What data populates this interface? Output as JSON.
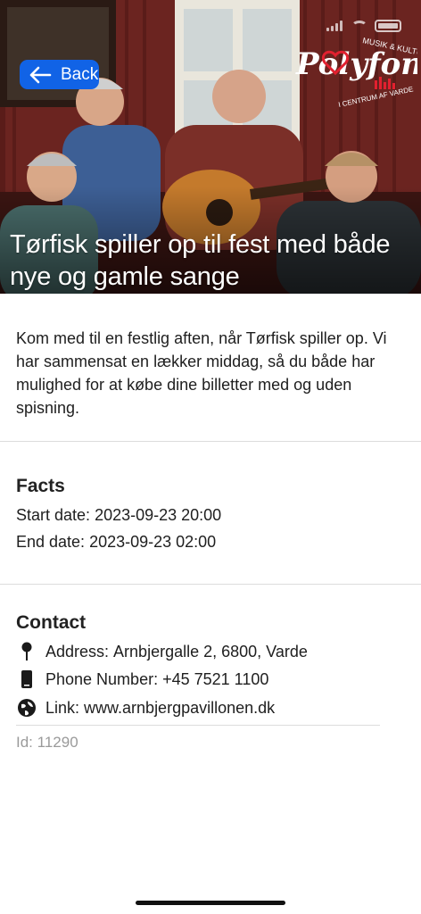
{
  "hero": {
    "title": "Tørfisk spiller op til fest med både nye og gamle sange",
    "back_label": "Back",
    "logo": {
      "wordmark": "Polyfon",
      "tagline_top": "MUSIK & KULTUR",
      "tagline_bottom": "I CENTRUM AF VARDE",
      "colors": {
        "text": "#ffffff",
        "heart": "#e2202f"
      }
    }
  },
  "description": "Kom med til en festlig aften, når Tørfisk spiller op. Vi har sammensat en lækker middag, så du både har mulighed for at købe dine billetter med og uden spisning.",
  "facts": {
    "title": "Facts",
    "start_label": "Start date:",
    "start_value": "2023-09-23 20:00",
    "end_label": "End date:",
    "end_value": "2023-09-23 02:00"
  },
  "contact": {
    "title": "Contact",
    "address_label": "Address:",
    "address_value": "Arnbjergalle 2, 6800, Varde",
    "phone_label": "Phone Number:",
    "phone_value": "+45 7521 1100",
    "link_label": "Link:",
    "link_value": "www.arnbjergpavillonen.dk",
    "icons": {
      "address": "pin-icon",
      "phone": "phone-icon",
      "link": "globe-icon"
    }
  },
  "id": {
    "label": "Id:",
    "value": "11290"
  },
  "colors": {
    "accent": "#1163e6",
    "divider": "#dcdcdc",
    "muted": "#9a9a9a"
  }
}
